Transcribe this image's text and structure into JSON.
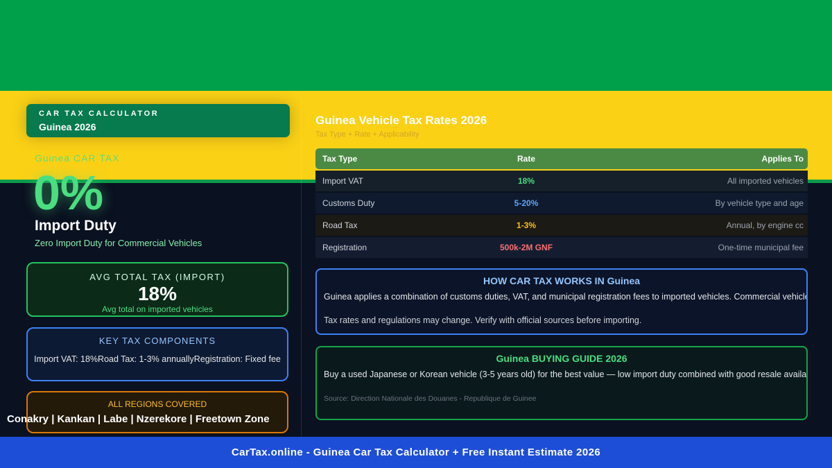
{
  "badge": {
    "kicker": "CAR TAX CALCULATOR",
    "country": "Guinea 2026"
  },
  "hero": {
    "label": "Guinea CAR TAX",
    "value": "0%",
    "subtitle": "Import Duty",
    "description": "Zero Import Duty for Commercial Vehicles"
  },
  "avg_card": {
    "title": "AVG TOTAL TAX (IMPORT)",
    "value": "18%",
    "description": "Avg total on imported vehicles"
  },
  "key_components": {
    "title": "KEY TAX COMPONENTS",
    "items": "Import VAT: 18%Road Tax: 1-3% annuallyRegistration: Fixed fee"
  },
  "regions": {
    "title": "ALL REGIONS COVERED",
    "list": "Conakry | Kankan | Labe | Nzerekore | Freetown Zone"
  },
  "rates": {
    "title": "Guinea Vehicle Tax Rates 2026",
    "subtitle": "Tax Type + Rate + Applicability",
    "headers": [
      "Tax Type",
      "Rate",
      "Applies To"
    ],
    "rows": [
      {
        "type": "Import VAT",
        "rate": "18%",
        "applies": "All imported vehicles",
        "color": "#4ade80"
      },
      {
        "type": "Customs Duty",
        "rate": "5-20%",
        "applies": "By vehicle type and age",
        "color": "#60a5fa"
      },
      {
        "type": "Road Tax",
        "rate": "1-3%",
        "applies": "Annual, by engine cc",
        "color": "#fbbf24"
      },
      {
        "type": "Registration",
        "rate": "500k-2M GNF",
        "applies": "One-time municipal fee",
        "color": "#f87171"
      }
    ]
  },
  "how_it_works": {
    "title": "HOW CAR TAX WORKS IN Guinea",
    "text": "Guinea applies a combination of customs duties, VAT, and municipal registration fees to imported vehicles. Commercial vehicles",
    "note": "Tax rates and regulations may change. Verify with official sources before importing."
  },
  "buying_guide": {
    "title": "Guinea BUYING GUIDE 2026",
    "text": "Buy a used Japanese or Korean vehicle (3-5 years old) for the best value — low import duty combined with good resale availabi",
    "source": "Source: Direction Nationale des Douanes - Republique de Guinee"
  },
  "footer": {
    "text": "CarTax.online - Guinea Car Tax Calculator + Free Instant Estimate 2026"
  }
}
